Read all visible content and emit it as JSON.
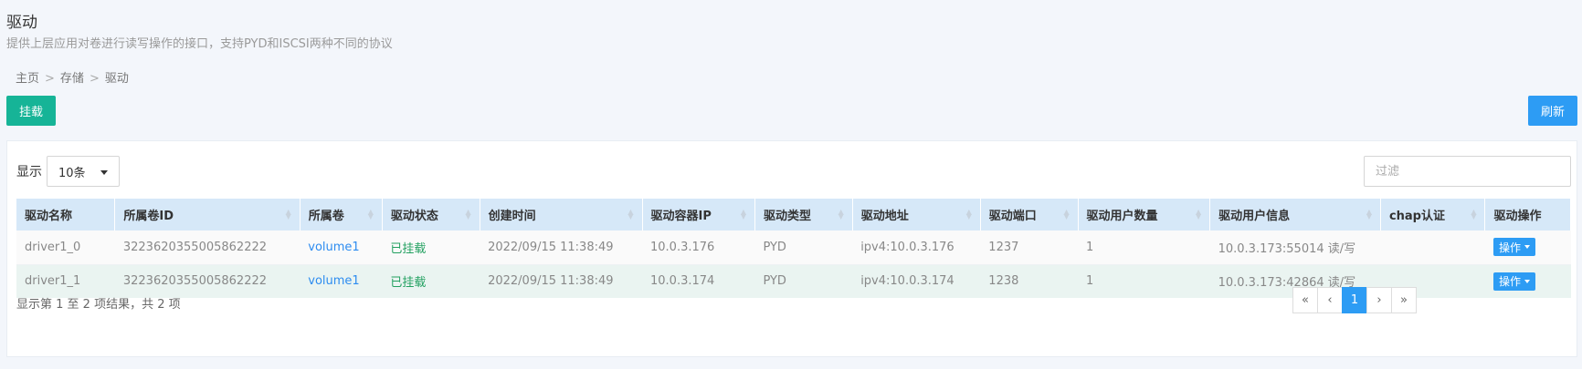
{
  "page": {
    "title": "驱动",
    "description": "提供上层应用对卷进行读写操作的接口，支持PYD和ISCSI两种不同的协议"
  },
  "breadcrumb": [
    "主页",
    "存储",
    "驱动"
  ],
  "breadcrumb_sep": ">",
  "toolbar": {
    "mount_label": "挂载",
    "refresh_label": "刷新"
  },
  "table_controls": {
    "show_label": "显示",
    "page_size": "10条",
    "filter_placeholder": "过滤"
  },
  "table": {
    "columns": [
      "驱动名称",
      "所属卷ID",
      "所属卷",
      "驱动状态",
      "创建时间",
      "驱动容器IP",
      "驱动类型",
      "驱动地址",
      "驱动端口",
      "驱动用户数量",
      "驱动用户信息",
      "chap认证",
      "驱动操作"
    ],
    "rows": [
      [
        "driver1_0",
        "3223620355005862222",
        "volume1",
        "已挂载",
        "2022/09/15 11:38:49",
        "10.0.3.176",
        "PYD",
        "ipv4:10.0.3.176",
        "1237",
        "1",
        "10.0.3.173:55014 读/写",
        "",
        "操作"
      ],
      [
        "driver1_1",
        "3223620355005862222",
        "volume1",
        "已挂载",
        "2022/09/15 11:38:49",
        "10.0.3.174",
        "PYD",
        "ipv4:10.0.3.174",
        "1238",
        "1",
        "10.0.3.173:42864 读/写",
        "",
        "操作"
      ]
    ]
  },
  "footer": {
    "summary": "显示第 1 至 2 项结果，共 2 项"
  },
  "pagination": {
    "first": "«",
    "prev": "‹",
    "current": "1",
    "next": "›",
    "last": "»"
  },
  "colors": {
    "mount_button": "#16b497",
    "primary": "#2d9cf4",
    "header_bg": "#d6e8f8",
    "status_mounted": "#22a060"
  }
}
